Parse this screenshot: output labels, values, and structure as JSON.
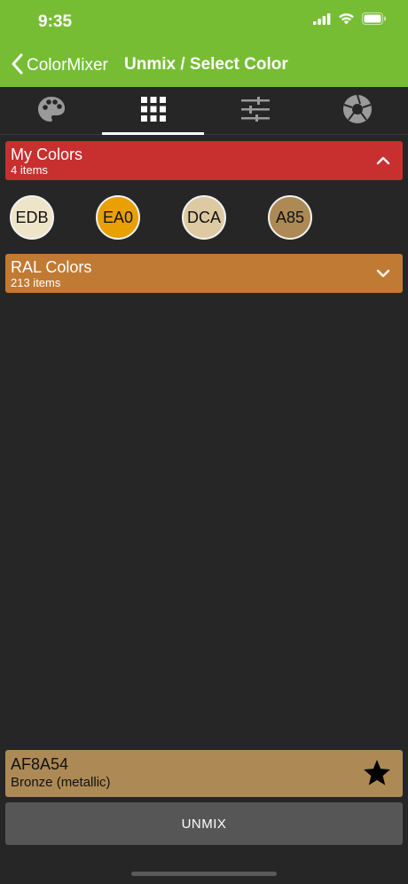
{
  "status": {
    "time": "9:35"
  },
  "nav": {
    "back_label": "ColorMixer",
    "title": "Unmix / Select Color"
  },
  "tabs": [
    {
      "icon": "palette-icon"
    },
    {
      "icon": "grid-icon"
    },
    {
      "icon": "sliders-icon"
    },
    {
      "icon": "aperture-icon"
    }
  ],
  "my_colors": {
    "title": "My Colors",
    "count": "4 items",
    "color": "#c82f2f",
    "swatches": [
      {
        "label": "EDB",
        "color": "#eee4c8"
      },
      {
        "label": "EA0",
        "color": "#e9a003"
      },
      {
        "label": "DCA",
        "color": "#decaa2"
      },
      {
        "label": "A85",
        "color": "#ad8a55"
      }
    ]
  },
  "ral_colors": {
    "title": "RAL Colors",
    "count": "213 items",
    "color": "#c07a33"
  },
  "selected": {
    "code": "AF8A54",
    "name": "Bronze (metallic)",
    "color": "#ad8a55"
  },
  "action": {
    "unmix_label": "UNMIX"
  },
  "theme": {
    "header": "#76bd34",
    "background": "#262626"
  }
}
